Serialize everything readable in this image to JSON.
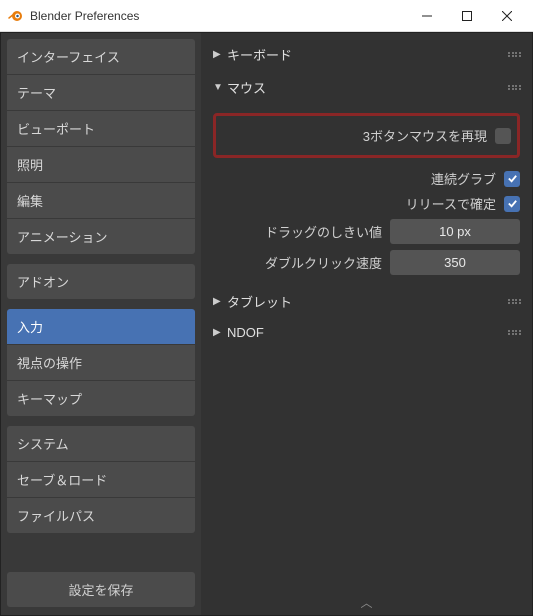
{
  "window": {
    "title": "Blender Preferences"
  },
  "sidebar": {
    "groups": [
      [
        "インターフェイス",
        "テーマ",
        "ビューポート",
        "照明",
        "編集",
        "アニメーション"
      ],
      [
        "アドオン"
      ],
      [
        "入力",
        "視点の操作",
        "キーマップ"
      ],
      [
        "システム",
        "セーブ＆ロード",
        "ファイルパス"
      ]
    ],
    "active": "入力",
    "save_label": "設定を保存"
  },
  "content": {
    "sections": {
      "keyboard": {
        "label": "キーボード",
        "expanded": false
      },
      "mouse": {
        "label": "マウス",
        "expanded": true,
        "emulate3": {
          "label": "3ボタンマウスを再現",
          "checked": false
        },
        "continuous": {
          "label": "連続グラブ",
          "checked": true
        },
        "release_confirm": {
          "label": "リリースで確定",
          "checked": true
        },
        "drag_threshold": {
          "label": "ドラッグのしきい値",
          "value": "10 px"
        },
        "dblclick": {
          "label": "ダブルクリック速度",
          "value": "350"
        }
      },
      "tablet": {
        "label": "タブレット",
        "expanded": false
      },
      "ndof": {
        "label": "NDOF",
        "expanded": false
      }
    }
  }
}
